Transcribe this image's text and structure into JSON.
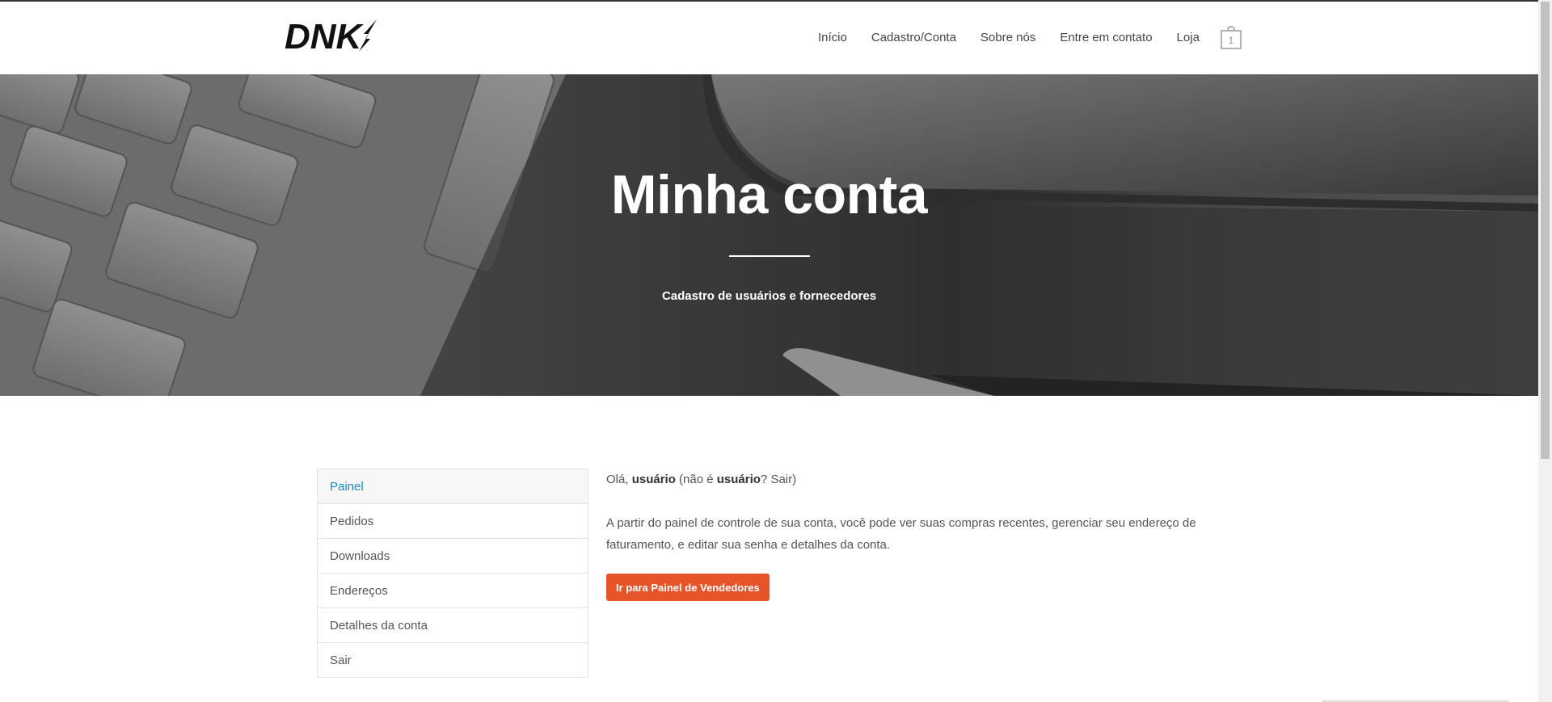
{
  "brand": {
    "logo_text": "DNK"
  },
  "nav": {
    "items": [
      "Início",
      "Cadastro/Conta",
      "Sobre nós",
      "Entre em contato",
      "Loja"
    ],
    "cart_count": "1"
  },
  "hero": {
    "title": "Minha conta",
    "subtitle": "Cadastro de usuários e fornecedores"
  },
  "account_menu": {
    "items": [
      "Painel",
      "Pedidos",
      "Downloads",
      "Endereços",
      "Detalhes da conta",
      "Sair"
    ],
    "active": "Painel"
  },
  "content": {
    "greeting_prefix": "Olá, ",
    "username": "usuário",
    "greeting_mid": " (não é ",
    "username_again": "usuário",
    "greeting_q": "? ",
    "logout_link": "Sair",
    "greeting_suffix": ")",
    "description": "A partir do painel de controle de sua conta, você pode ver suas compras recentes, gerenciar seu endereço de faturamento, e editar sua senha e detalhes da conta.",
    "vendor_button": "Ir para Painel de Vendedores"
  },
  "colors": {
    "accent_link": "#1e88c8",
    "button": "#e8542a"
  }
}
